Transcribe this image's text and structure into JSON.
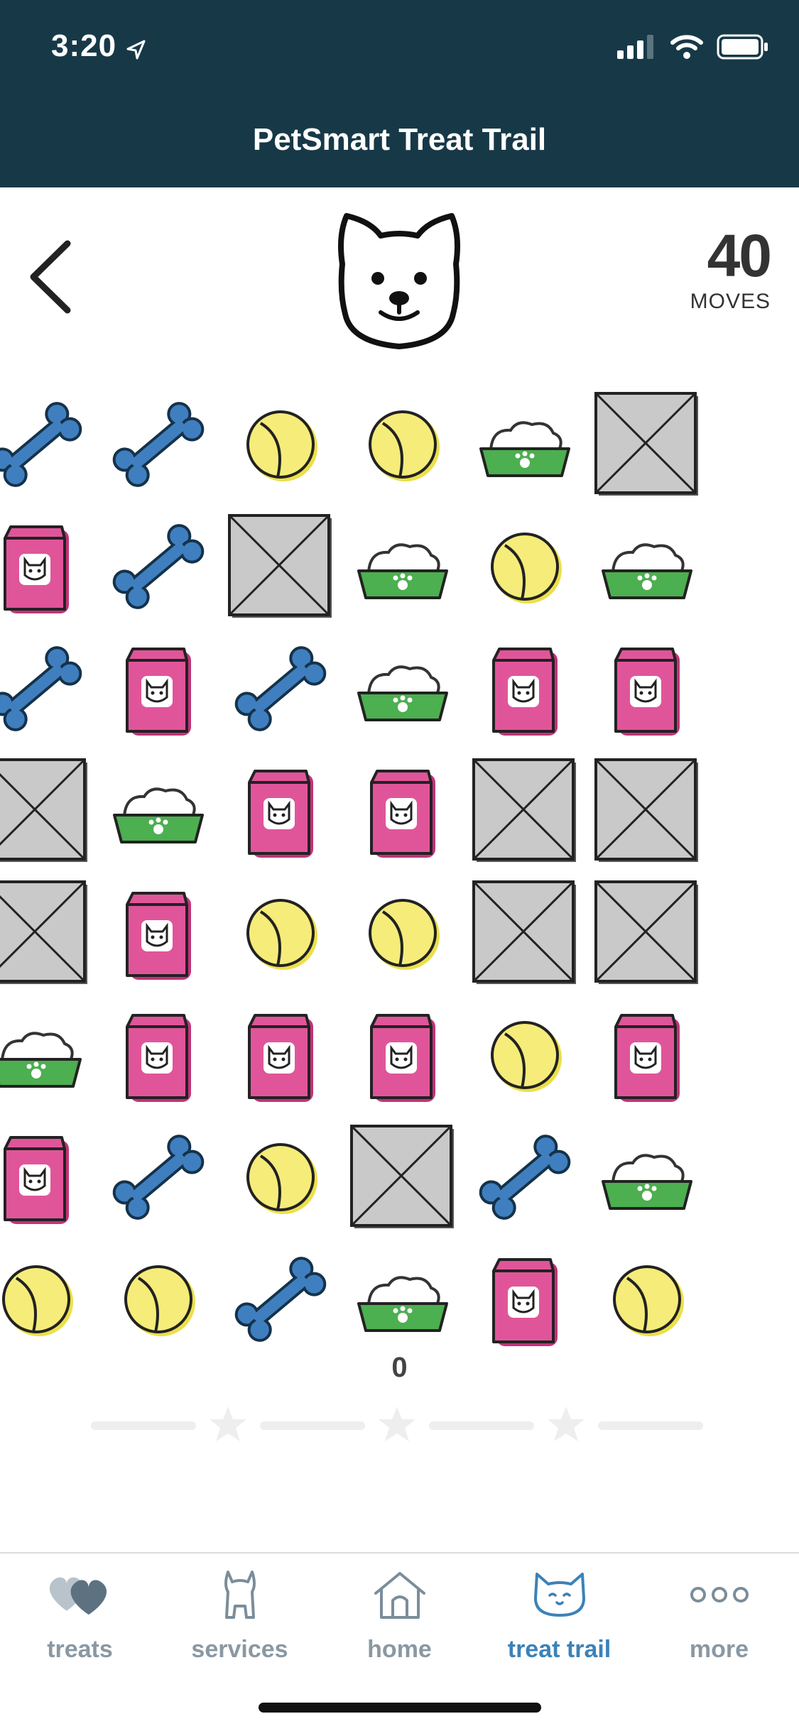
{
  "status_bar": {
    "time": "3:20"
  },
  "header": {
    "title": "PetSmart Treat Trail"
  },
  "game": {
    "moves_count": "40",
    "moves_label": "MOVES",
    "score": "0",
    "stars_filled": 0,
    "grid": [
      [
        "bone",
        "bone",
        "ball",
        "ball",
        "bowl",
        "box"
      ],
      [
        "bag",
        "bone",
        "box",
        "bowl",
        "ball",
        "bowl"
      ],
      [
        "bone",
        "bag",
        "bone",
        "bowl",
        "bag",
        "bag"
      ],
      [
        "box",
        "bowl",
        "bag",
        "bag",
        "box",
        "box"
      ],
      [
        "box",
        "bag",
        "ball",
        "ball",
        "box",
        "box"
      ],
      [
        "bowl",
        "bag",
        "bag",
        "bag",
        "ball",
        "bag"
      ],
      [
        "bag",
        "bone",
        "ball",
        "box",
        "bone",
        "bowl"
      ],
      [
        "ball",
        "ball",
        "bone",
        "bowl",
        "bag",
        "ball"
      ]
    ]
  },
  "tabs": [
    {
      "label": "treats",
      "icon": "hearts-icon",
      "active": false
    },
    {
      "label": "services",
      "icon": "dog-icon",
      "active": false
    },
    {
      "label": "home",
      "icon": "house-icon",
      "active": false
    },
    {
      "label": "treat trail",
      "icon": "cat-icon",
      "active": true
    },
    {
      "label": "more",
      "icon": "more-dots-icon",
      "active": false
    }
  ],
  "colors": {
    "header_bg": "#173947",
    "bone": "#3f7fbf",
    "ball": "#f5ec7a",
    "bowl": "#4caf50",
    "bag": "#e0559a",
    "box": "#c9c9c9",
    "active_tab": "#3b82b8",
    "inactive_tab": "#8a98a3"
  }
}
